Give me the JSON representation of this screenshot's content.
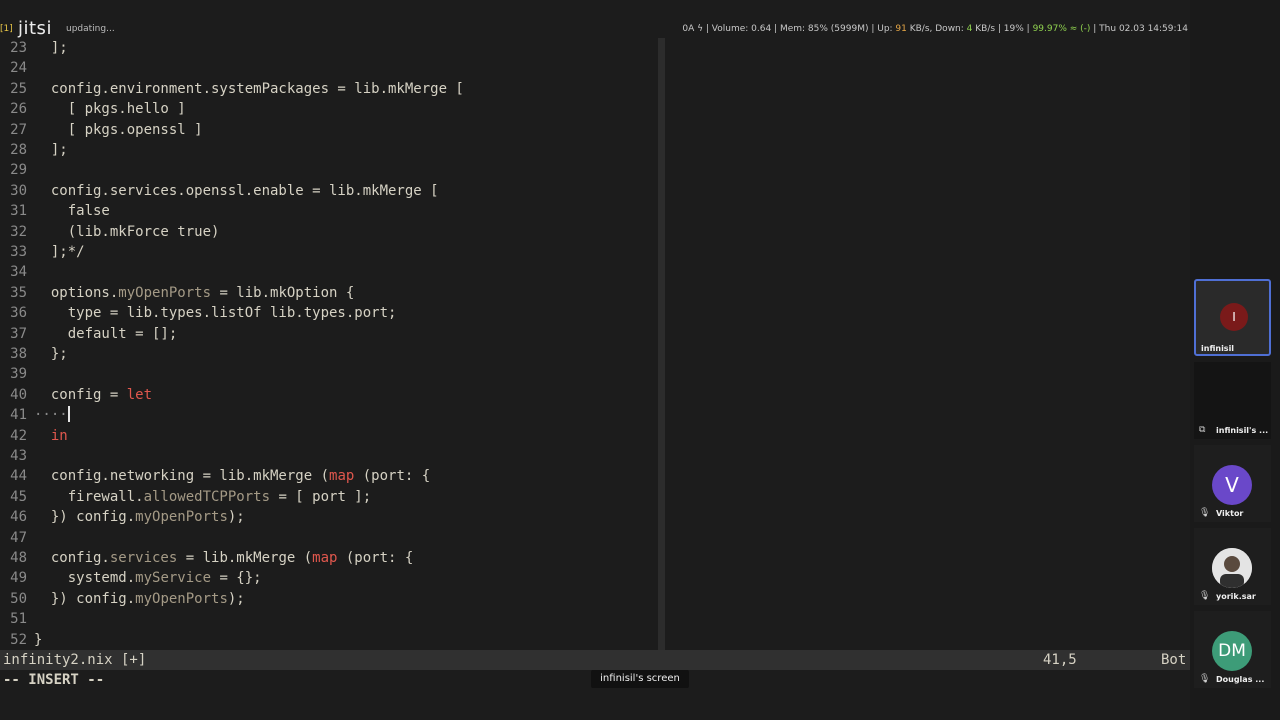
{
  "topbar": {
    "workspace": "[1]",
    "updating": "updating...",
    "stats_pre": "0A ϟ | Volume: 0.64 | Mem: 85% (5999M) | Up: ",
    "up_value": "91",
    "stats_mid": " KB/s, Down: ",
    "down_value": "4",
    "stats_mid2": " KB/s | 19% | ",
    "battery": "99.97% ≈ (-)",
    "datetime": " | Thu 02.03 14:59:14"
  },
  "app": {
    "logo": "jitsi"
  },
  "editor": {
    "lines": [
      {
        "n": "23",
        "html": "  ];"
      },
      {
        "n": "24",
        "html": ""
      },
      {
        "n": "25",
        "html": "  config.environment.systemPackages = lib.mkMerge ["
      },
      {
        "n": "26",
        "html": "    [ pkgs.hello ]"
      },
      {
        "n": "27",
        "html": "    [ pkgs.openssl ]"
      },
      {
        "n": "28",
        "html": "  ];"
      },
      {
        "n": "29",
        "html": ""
      },
      {
        "n": "30",
        "html": "  config.services.openssl.enable = lib.mkMerge ["
      },
      {
        "n": "31",
        "html": "    false"
      },
      {
        "n": "32",
        "html": "    (lib.mkForce true)"
      },
      {
        "n": "33",
        "html": "  ];*/"
      },
      {
        "n": "34",
        "html": ""
      },
      {
        "n": "35",
        "html": "  options.myOpenPorts = lib.mkOption {"
      },
      {
        "n": "36",
        "html": "    type = lib.types.listOf lib.types.port;"
      },
      {
        "n": "37",
        "html": "    default = [];"
      },
      {
        "n": "38",
        "html": "  };"
      },
      {
        "n": "39",
        "html": ""
      },
      {
        "n": "40",
        "html": "  config = let"
      },
      {
        "n": "41",
        "html": "····"
      },
      {
        "n": "42",
        "html": "  in"
      },
      {
        "n": "43",
        "html": ""
      },
      {
        "n": "44",
        "html": "  config.networking = lib.mkMerge (map (port: {"
      },
      {
        "n": "45",
        "html": "    firewall.allowedTCPPorts = [ port ];"
      },
      {
        "n": "46",
        "html": "  }) config.myOpenPorts);"
      },
      {
        "n": "47",
        "html": ""
      },
      {
        "n": "48",
        "html": "  config.services = lib.mkMerge (map (port: {"
      },
      {
        "n": "49",
        "html": "    systemd.myService = {};"
      },
      {
        "n": "50",
        "html": "  }) config.myOpenPorts);"
      },
      {
        "n": "51",
        "html": ""
      },
      {
        "n": "52",
        "html": "}"
      }
    ],
    "statusline": {
      "file": "infinity2.nix [+]",
      "position": "41,5",
      "scroll": "Bot"
    },
    "mode": "-- INSERT --"
  },
  "screen_share_label": "infinisil's screen",
  "participants": [
    {
      "name": "infinisil",
      "initial": "I",
      "color": "#7a1a1a",
      "active": true
    },
    {
      "name": "infinisil's ...",
      "type": "screen"
    },
    {
      "name": "Viktor",
      "initial": "V",
      "color": "#6a48c9"
    },
    {
      "name": "yorik.sar",
      "type": "photo"
    },
    {
      "name": "Douglas ...",
      "initial": "DM",
      "color": "#3d9c78"
    }
  ],
  "colors": {
    "accent": "#4f6fd4",
    "keyword": "#e0574d",
    "background": "#1c1c1c"
  }
}
